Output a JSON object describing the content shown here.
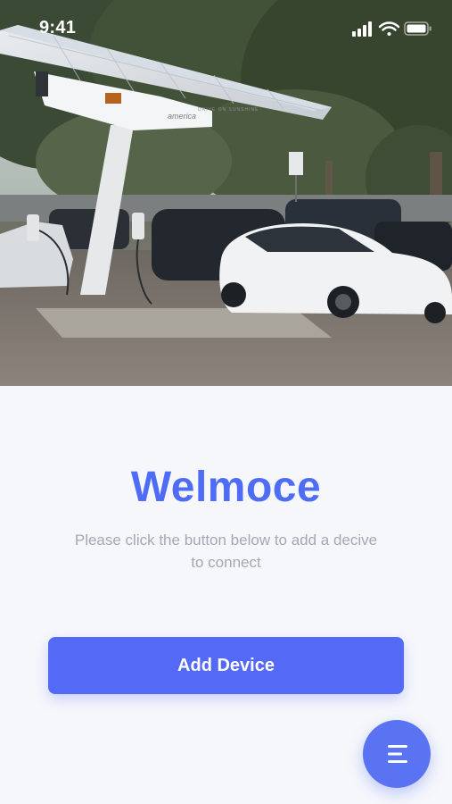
{
  "status_bar": {
    "time": "9:41",
    "icons": [
      "signal-bars-icon",
      "wifi-icon",
      "battery-icon"
    ]
  },
  "hero": {
    "image": "solar-carport-ev-charging-photo",
    "carport_sign_text": "america",
    "carport_tagline_text": "DRIVE ON SUNSHINE"
  },
  "welcome": {
    "title": "Welmoce",
    "subtitle": "Please click the button below to  add a decive to connect"
  },
  "actions": {
    "add_device_label": "Add Device",
    "menu_fab_icon": "menu-lines-icon"
  },
  "colors": {
    "accent": "#5469f6",
    "title": "#4f6cf5",
    "subtitle": "#a3a8b6",
    "background": "#f5f7fb"
  }
}
